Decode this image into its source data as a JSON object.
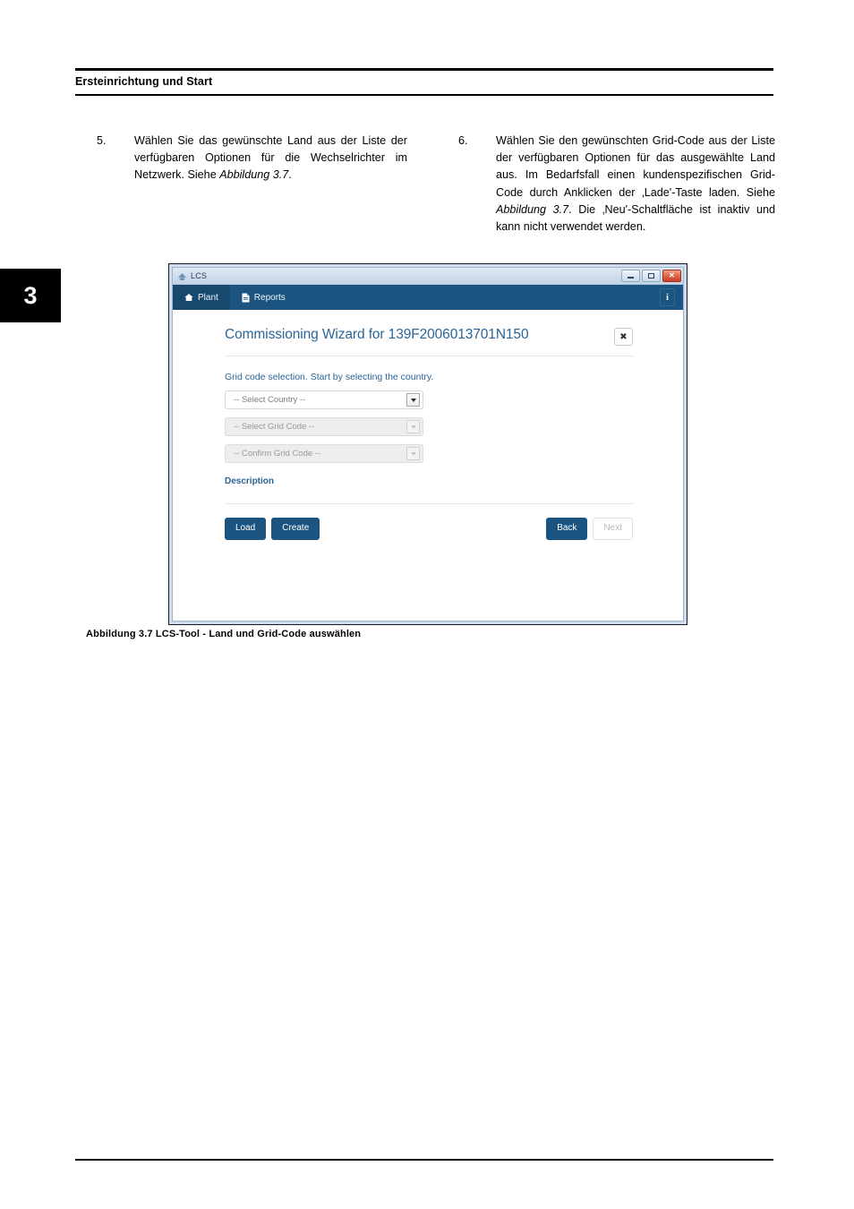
{
  "page": {
    "running_head": "Ersteinrichtung und Start",
    "chapter_number": "3"
  },
  "steps": [
    {
      "number": "5.",
      "text_parts": [
        {
          "text": "Wählen Sie das gewünschte Land aus der Liste der verfügbaren Optionen für die Wechselrichter im Netzwerk. Siehe ",
          "italic": false
        },
        {
          "text": "Abbildung 3.7",
          "italic": true
        },
        {
          "text": ".",
          "italic": false
        }
      ],
      "text": "Wählen Sie das gewünschte Land aus der Liste der verfügbaren Optionen für die Wechselrichter im Netzwerk. Siehe Abbildung 3.7."
    },
    {
      "number": "6.",
      "text_parts": [
        {
          "text": "Wählen Sie den gewünschten Grid-Code aus der Liste der verfügbaren Optionen für das ausgewählte Land aus. Im Bedarfsfall einen kundenspezifischen Grid-Code durch Anklicken der ‚Lade'-Taste laden. Siehe ",
          "italic": false
        },
        {
          "text": "Abbildung 3.7",
          "italic": true
        },
        {
          "text": ". Die ‚Neu'-Schaltfläche ist inaktiv und kann nicht verwendet werden.",
          "italic": false
        }
      ],
      "text": "Wählen Sie den gewünschten Grid-Code aus der Liste der verfügbaren Optionen für das ausgewählte Land aus. Im Bedarfsfall einen kundenspezifischen Grid-Code durch Anklicken der ‚Lade'-Taste laden. Siehe Abbildung 3.7. Die ‚Neu'-Schaltfläche ist inaktiv und kann nicht verwendet werden."
    }
  ],
  "figure": {
    "caption": "Abbildung 3.7 LCS-Tool - Land und Grid-Code auswählen",
    "window": {
      "title": "LCS",
      "title_icon": "app-icon",
      "controls": {
        "minimize": "minimize-icon",
        "maximize": "maximize-icon",
        "close": "close-icon",
        "close_glyph": "✕"
      },
      "navbar": {
        "items": [
          {
            "label": "Plant",
            "icon": "home-icon",
            "active": true
          },
          {
            "label": "Reports",
            "icon": "file-icon",
            "active": false
          }
        ],
        "info_label": "i",
        "info_icon": "info-icon"
      },
      "wizard": {
        "title": "Commissioning Wizard for 139F2006013701N150",
        "close_glyph": "✖",
        "intro": "Grid code selection. Start by selecting the country.",
        "selects": [
          {
            "value": "-- Select Country --",
            "disabled": false
          },
          {
            "value": "-- Select Grid Code --",
            "disabled": true
          },
          {
            "value": "-- Confirm Grid Code --",
            "disabled": true
          }
        ],
        "description_label": "Description",
        "buttons": {
          "left": [
            {
              "label": "Load",
              "disabled": false
            },
            {
              "label": "Create",
              "disabled": false
            }
          ],
          "right": [
            {
              "label": "Back",
              "disabled": false
            },
            {
              "label": "Next",
              "disabled": true
            }
          ]
        }
      }
    },
    "colors": {
      "navbar_blue": "#1b5480",
      "heading_blue": "#2a6496",
      "titlebar_blue": "#cfdced",
      "close_red": "#c3402a"
    }
  }
}
